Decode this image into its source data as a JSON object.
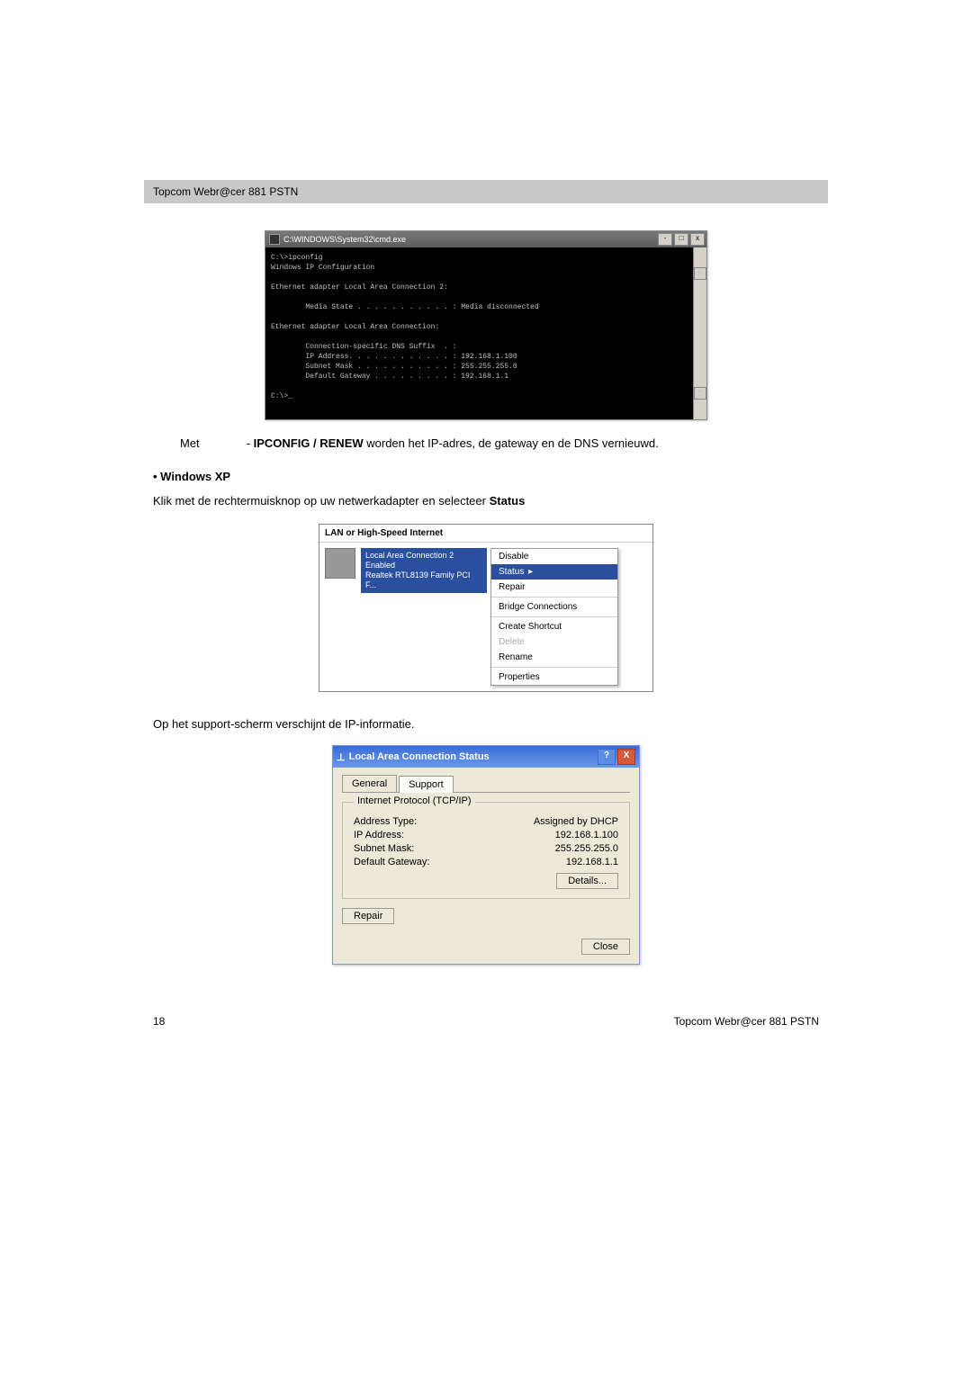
{
  "header": "Topcom Webr@cer 881 PSTN",
  "cmd": {
    "title": "C:\\WINDOWS\\System32\\cmd.exe",
    "body": "C:\\>ipconfig\nWindows IP Configuration\n\nEthernet adapter Local Area Connection 2:\n\n        Media State . . . . . . . . . . . : Media disconnected\n\nEthernet adapter Local Area Connection:\n\n        Connection-specific DNS Suffix  . :\n        IP Address. . . . . . . . . . . . : 192.168.1.100\n        Subnet Mask . . . . . . . . . . . : 255.255.255.0\n        Default Gateway . . . . . . . . . : 192.168.1.1\n\nC:\\>_"
  },
  "line1": {
    "met": "Met",
    "dash": "- ",
    "bold": "IPCONFIG / RENEW",
    "rest": " worden het IP-adres, de gateway en de DNS vernieuwd."
  },
  "section_head": "• Windows XP",
  "line2": {
    "pre": "Klik met de rechtermuisknop op uw netwerkadapter en selecteer ",
    "bold": "Status"
  },
  "ctx": {
    "header": "LAN or High-Speed Internet",
    "conn_l1": "Local Area Connection 2",
    "conn_l2": "Enabled",
    "conn_l3": "Realtek RTL8139 Family PCI F...",
    "items": {
      "disable": "Disable",
      "status": "Status",
      "repair": "Repair",
      "bridge": "Bridge Connections",
      "shortcut": "Create Shortcut",
      "delete": "Delete",
      "rename": "Rename",
      "properties": "Properties"
    }
  },
  "line3": "Op het support-scherm verschijnt de IP-informatie.",
  "dlg": {
    "title": "Local Area Connection Status",
    "tab_general": "General",
    "tab_support": "Support",
    "group_title": "Internet Protocol (TCP/IP)",
    "rows": {
      "addr_type_l": "Address Type:",
      "addr_type_v": "Assigned by DHCP",
      "ip_l": "IP Address:",
      "ip_v": "192.168.1.100",
      "mask_l": "Subnet Mask:",
      "mask_v": "255.255.255.0",
      "gw_l": "Default Gateway:",
      "gw_v": "192.168.1.1"
    },
    "btn_details": "Details...",
    "btn_repair": "Repair",
    "btn_close": "Close"
  },
  "footer": {
    "page": "18",
    "brand": "Topcom Webr@cer 881 PSTN"
  }
}
